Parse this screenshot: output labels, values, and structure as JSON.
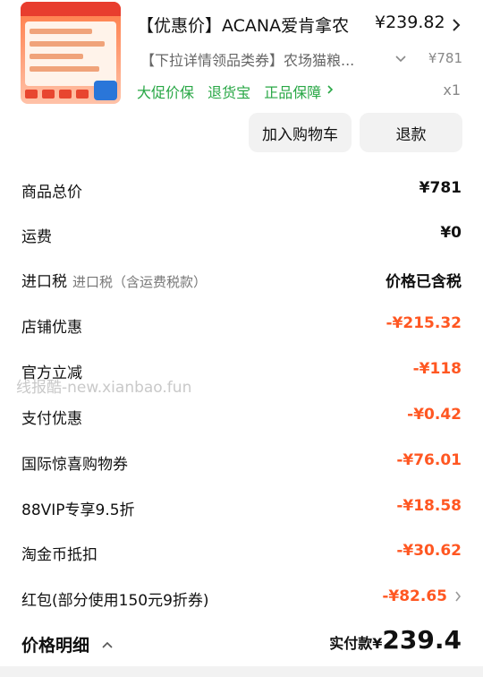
{
  "product": {
    "title": "【优惠价】ACANA爱肯拿农",
    "price": "¥239.82",
    "sku": "【下拉详情领品类券】农场猫粮...",
    "sku_price": "¥781",
    "tags": [
      "大促价保",
      "退货宝",
      "正品保障"
    ],
    "quantity": "x1",
    "thumbnail_text": {
      "banner": "双11现货 3 这么拍最优惠",
      "step1": "1.直播间整点抢专属优惠",
      "step2": "2.新会员领10元券",
      "step3": "3.88VIP领专享券",
      "badge": "354",
      "prices": [
        "424",
        "10",
        "21",
        "39"
      ]
    }
  },
  "actions": {
    "add_to_cart": "加入购物车",
    "refund": "退款"
  },
  "summary": {
    "rows": [
      {
        "label": "商品总价",
        "value": "¥781"
      },
      {
        "label": "运费",
        "value": "¥0"
      },
      {
        "label": "进口税",
        "sublabel": "进口税（含运费税款）",
        "value": "价格已含税"
      },
      {
        "label": "店铺优惠",
        "value": "-¥215.32"
      },
      {
        "label": "官方立减",
        "value": "-¥118"
      },
      {
        "label": "支付优惠",
        "value": "-¥0.42"
      },
      {
        "label": "国际惊喜购物券",
        "value": "-¥76.01"
      },
      {
        "label": "88VIP专享9.5折",
        "value": "-¥18.58"
      },
      {
        "label": "淘金币抵扣",
        "value": "-¥30.62"
      },
      {
        "label": "红包(部分使用150元9折券)",
        "value": "-¥82.65"
      }
    ]
  },
  "footer": {
    "label": "价格明细",
    "paid_label": "实付款¥",
    "paid_amount": "239.4"
  },
  "watermark": "线报酷-new.xianbao.fun",
  "colors": {
    "discount": "#ff5722",
    "tag_green": "#28a745"
  }
}
